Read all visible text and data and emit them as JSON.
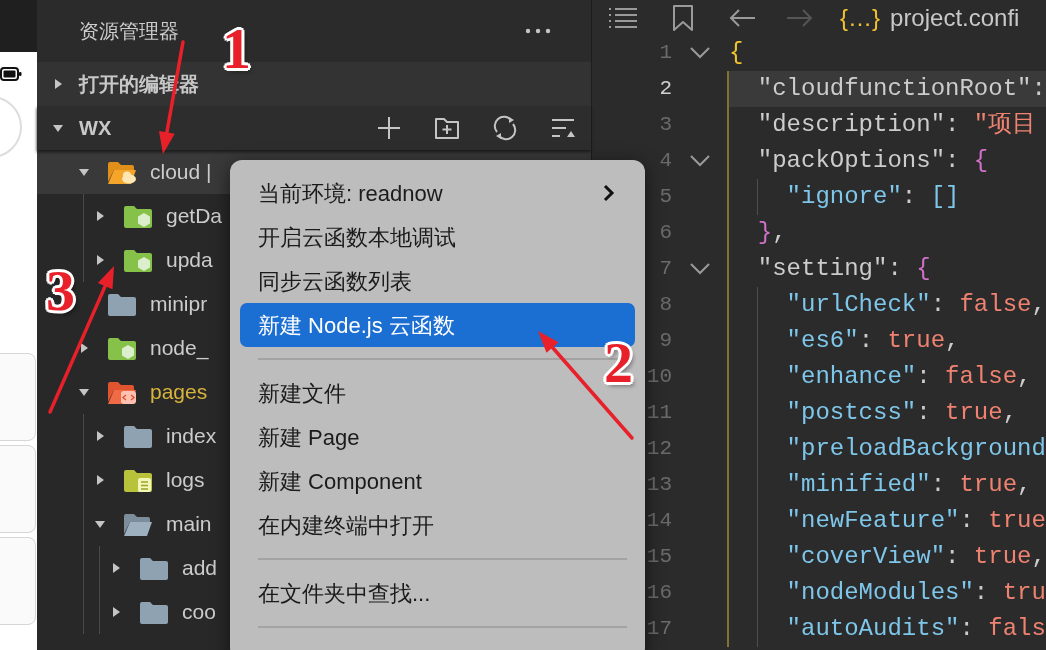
{
  "explorer": {
    "title": "资源管理器",
    "sections": [
      {
        "label": "打开的编辑器",
        "expanded": false
      },
      {
        "label": "WX",
        "expanded": true
      }
    ],
    "tree": [
      {
        "label": "cloud |",
        "kind": "cloud",
        "expanded": true,
        "selected": true,
        "modified": false,
        "children": [
          {
            "label": "getDa",
            "kind": "function",
            "expanded": false,
            "selected": false,
            "modified": false
          },
          {
            "label": "upda",
            "kind": "function",
            "expanded": false,
            "selected": false,
            "modified": false
          }
        ]
      },
      {
        "label": "minipr",
        "kind": "folder",
        "selected": false,
        "modified": false
      },
      {
        "label": "node_",
        "kind": "function",
        "expanded": false,
        "selected": false,
        "modified": false
      },
      {
        "label": "pages",
        "kind": "pages",
        "expanded": true,
        "selected": false,
        "modified": true,
        "children": [
          {
            "label": "index",
            "kind": "folder",
            "expanded": false,
            "selected": false,
            "modified": false
          },
          {
            "label": "logs",
            "kind": "logs",
            "expanded": false,
            "selected": false,
            "modified": false
          },
          {
            "label": "main",
            "kind": "folder",
            "expanded": true,
            "selected": false,
            "modified": false,
            "children": [
              {
                "label": "add",
                "kind": "folder",
                "expanded": false,
                "selected": false,
                "modified": false
              },
              {
                "label": "coo",
                "kind": "folder",
                "expanded": false,
                "selected": false,
                "modified": false
              }
            ]
          }
        ]
      }
    ]
  },
  "context_menu": [
    {
      "kind": "item",
      "label": "当前环境: readnow",
      "submenu": true,
      "selected": false
    },
    {
      "kind": "item",
      "label": "开启云函数本地调试",
      "selected": false
    },
    {
      "kind": "item",
      "label": "同步云函数列表",
      "selected": false
    },
    {
      "kind": "item",
      "label": "新建 Node.js 云函数",
      "selected": true
    },
    {
      "kind": "separator"
    },
    {
      "kind": "item",
      "label": "新建文件",
      "selected": false
    },
    {
      "kind": "item",
      "label": "新建 Page",
      "selected": false
    },
    {
      "kind": "item",
      "label": "新建 Component",
      "selected": false
    },
    {
      "kind": "item",
      "label": "在内建终端中打开",
      "selected": false
    },
    {
      "kind": "separator"
    },
    {
      "kind": "item",
      "label": "在文件夹中查找...",
      "selected": false
    },
    {
      "kind": "separator"
    }
  ],
  "editor": {
    "tab": {
      "icon": "{…}",
      "title": "project.confi"
    },
    "lines": [
      {
        "number": "1",
        "fold": true,
        "current": false,
        "tokens": [
          {
            "kind": "brace1",
            "text": "{"
          }
        ]
      },
      {
        "number": "2",
        "fold": false,
        "current": true,
        "tokens": [
          {
            "kind": "key1",
            "text": "  \"cloudfunctionRoot\""
          },
          {
            "kind": "punct",
            "text": ":"
          }
        ]
      },
      {
        "number": "3",
        "fold": false,
        "current": false,
        "tokens": [
          {
            "kind": "key1",
            "text": "  \"description\""
          },
          {
            "kind": "punct",
            "text": ": "
          },
          {
            "kind": "string",
            "text": "\"项目"
          }
        ]
      },
      {
        "number": "4",
        "fold": true,
        "current": false,
        "tokens": [
          {
            "kind": "key1",
            "text": "  \"packOptions\""
          },
          {
            "kind": "punct",
            "text": ": "
          },
          {
            "kind": "brace2",
            "text": "{"
          }
        ]
      },
      {
        "number": "5",
        "fold": false,
        "current": false,
        "tokens": [
          {
            "kind": "key2",
            "text": "    \"ignore\""
          },
          {
            "kind": "punct",
            "text": ": "
          },
          {
            "kind": "bracket",
            "text": "[]"
          }
        ]
      },
      {
        "number": "6",
        "fold": false,
        "current": false,
        "tokens": [
          {
            "kind": "brace2",
            "text": "  }"
          },
          {
            "kind": "punct",
            "text": ","
          }
        ]
      },
      {
        "number": "7",
        "fold": true,
        "current": false,
        "tokens": [
          {
            "kind": "key1",
            "text": "  \"setting\""
          },
          {
            "kind": "punct",
            "text": ": "
          },
          {
            "kind": "brace2",
            "text": "{"
          }
        ]
      },
      {
        "number": "8",
        "fold": false,
        "current": false,
        "tokens": [
          {
            "kind": "key2",
            "text": "    \"urlCheck\""
          },
          {
            "kind": "punct",
            "text": ": "
          },
          {
            "kind": "value",
            "text": "false"
          },
          {
            "kind": "punct",
            "text": ","
          }
        ]
      },
      {
        "number": "9",
        "fold": false,
        "current": false,
        "tokens": [
          {
            "kind": "key2",
            "text": "    \"es6\""
          },
          {
            "kind": "punct",
            "text": ": "
          },
          {
            "kind": "value",
            "text": "true"
          },
          {
            "kind": "punct",
            "text": ","
          }
        ]
      },
      {
        "number": "10",
        "fold": false,
        "current": false,
        "tokens": [
          {
            "kind": "key2",
            "text": "    \"enhance\""
          },
          {
            "kind": "punct",
            "text": ": "
          },
          {
            "kind": "value",
            "text": "false"
          },
          {
            "kind": "punct",
            "text": ","
          }
        ]
      },
      {
        "number": "11",
        "fold": false,
        "current": false,
        "tokens": [
          {
            "kind": "key2",
            "text": "    \"postcss\""
          },
          {
            "kind": "punct",
            "text": ": "
          },
          {
            "kind": "value",
            "text": "true"
          },
          {
            "kind": "punct",
            "text": ","
          }
        ]
      },
      {
        "number": "12",
        "fold": false,
        "current": false,
        "tokens": [
          {
            "kind": "key2",
            "text": "    \"preloadBackground"
          }
        ]
      },
      {
        "number": "13",
        "fold": false,
        "current": false,
        "tokens": [
          {
            "kind": "key2",
            "text": "    \"minified\""
          },
          {
            "kind": "punct",
            "text": ": "
          },
          {
            "kind": "value",
            "text": "true"
          },
          {
            "kind": "punct",
            "text": ","
          }
        ]
      },
      {
        "number": "14",
        "fold": false,
        "current": false,
        "tokens": [
          {
            "kind": "key2",
            "text": "    \"newFeature\""
          },
          {
            "kind": "punct",
            "text": ": "
          },
          {
            "kind": "value",
            "text": "true"
          }
        ]
      },
      {
        "number": "15",
        "fold": false,
        "current": false,
        "tokens": [
          {
            "kind": "key2",
            "text": "    \"coverView\""
          },
          {
            "kind": "punct",
            "text": ": "
          },
          {
            "kind": "value",
            "text": "true"
          },
          {
            "kind": "punct",
            "text": ","
          }
        ]
      },
      {
        "number": "16",
        "fold": false,
        "current": false,
        "tokens": [
          {
            "kind": "key2",
            "text": "    \"nodeModules\""
          },
          {
            "kind": "punct",
            "text": ": "
          },
          {
            "kind": "value",
            "text": "tru"
          }
        ]
      },
      {
        "number": "17",
        "fold": false,
        "current": false,
        "tokens": [
          {
            "kind": "key2",
            "text": "    \"autoAudits\""
          },
          {
            "kind": "punct",
            "text": ": "
          },
          {
            "kind": "value",
            "text": "fals"
          }
        ]
      }
    ]
  },
  "annotations": [
    {
      "label": "1"
    },
    {
      "label": "2"
    },
    {
      "label": "3"
    }
  ]
}
